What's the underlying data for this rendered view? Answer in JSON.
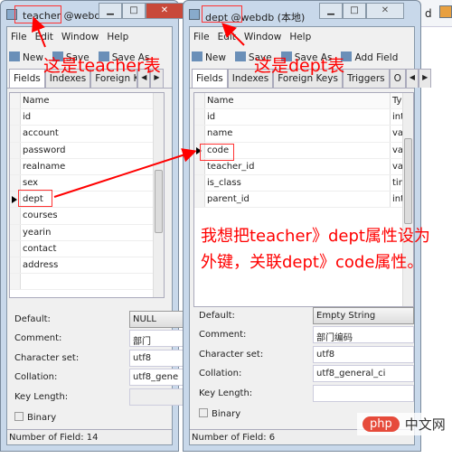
{
  "background_app": {
    "text": "d"
  },
  "left_window": {
    "title": "teacher @webd...",
    "menu": [
      "File",
      "Edit",
      "Window",
      "Help"
    ],
    "toolbar": [
      "New",
      "Save",
      "Save As"
    ],
    "tabs": [
      "Fields",
      "Indexes",
      "Foreign Key"
    ],
    "column_header": "Name",
    "fields": [
      "id",
      "account",
      "password",
      "realname",
      "sex",
      "dept",
      "courses",
      "yearin",
      "contact",
      "address"
    ],
    "selected_field": "dept",
    "properties": {
      "default_label": "Default:",
      "default_value": "NULL",
      "comment_label": "Comment:",
      "comment_value": "部门",
      "charset_label": "Character set:",
      "charset_value": "utf8",
      "collation_label": "Collation:",
      "collation_value": "utf8_gene",
      "key_length_label": "Key Length:",
      "binary_label": "Binary"
    },
    "status": "Number of Field: 14"
  },
  "right_window": {
    "title": "dept @webdb (本地)",
    "menu": [
      "File",
      "Edit",
      "Window",
      "Help"
    ],
    "toolbar": [
      "New",
      "Save",
      "Save As",
      "Add Field"
    ],
    "tabs": [
      "Fields",
      "Indexes",
      "Foreign Keys",
      "Triggers",
      "O"
    ],
    "column_header": "Name",
    "type_header": "Typ",
    "fields": [
      {
        "name": "id",
        "type": "int"
      },
      {
        "name": "name",
        "type": "var"
      },
      {
        "name": "code",
        "type": "var"
      },
      {
        "name": "teacher_id",
        "type": "var"
      },
      {
        "name": "is_class",
        "type": "tiny"
      },
      {
        "name": "parent_id",
        "type": "int"
      }
    ],
    "selected_field": "code",
    "properties": {
      "default_label": "Default:",
      "default_value": "Empty String",
      "comment_label": "Comment:",
      "comment_value": "部门编码",
      "charset_label": "Character set:",
      "charset_value": "utf8",
      "collation_label": "Collation:",
      "collation_value": "utf8_general_ci",
      "key_length_label": "Key Length:",
      "binary_label": "Binary"
    },
    "status": "Number of Field: 6"
  },
  "annotations": {
    "teacher_label": "这是teacher表",
    "dept_label": "这是dept表",
    "note_line1": "我想把teacher》dept属性设为",
    "note_line2": "外键，关联dept》code属性。",
    "color": "#ff0000"
  },
  "watermark": {
    "php": "php",
    "cn": "中文网"
  }
}
